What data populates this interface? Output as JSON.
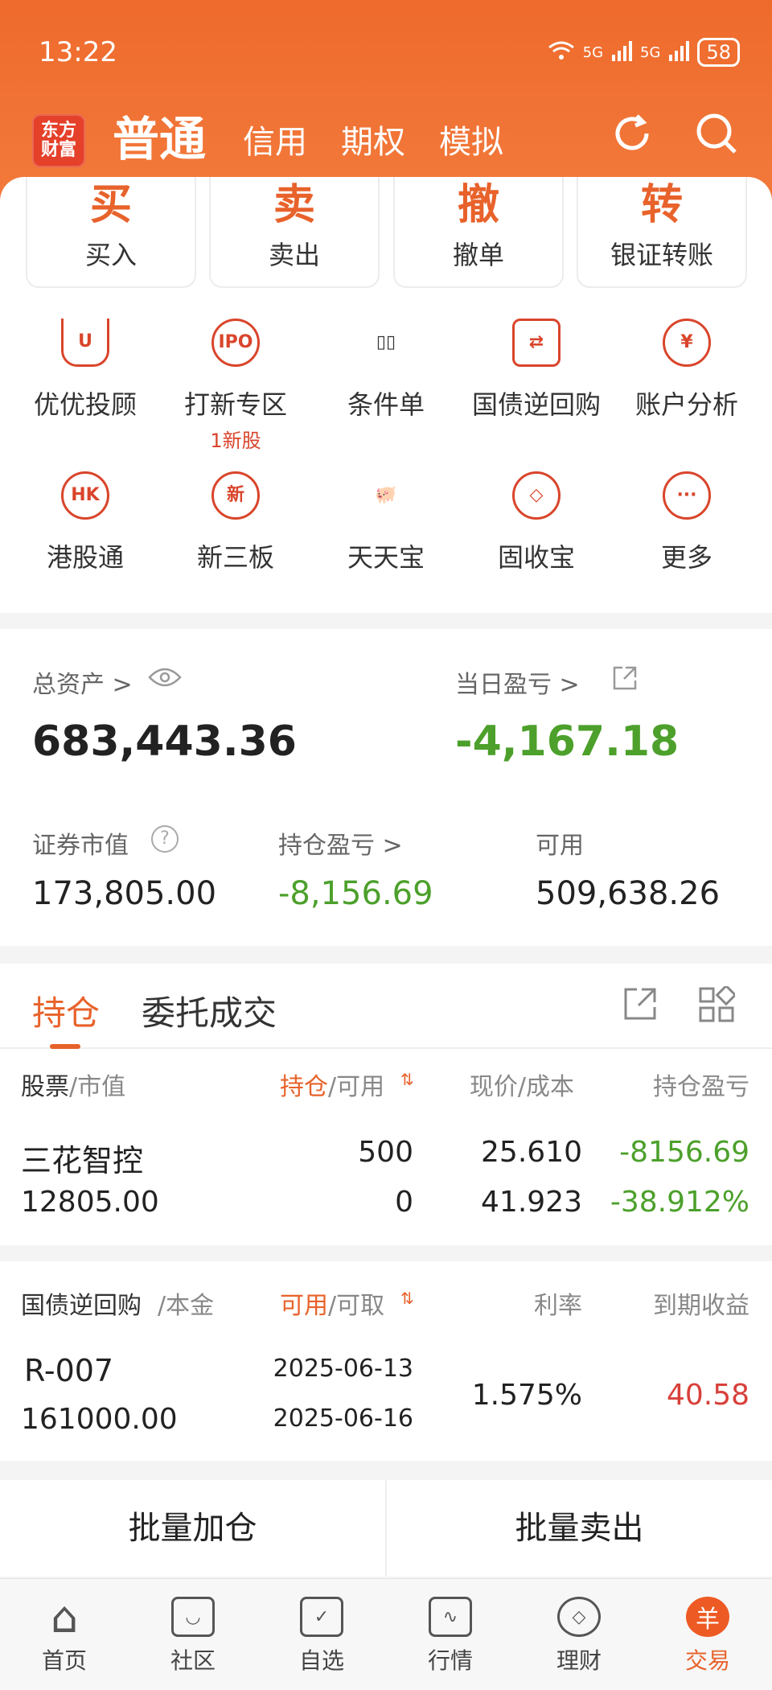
{
  "status_bar": {
    "time": "13:22",
    "network1": "5G",
    "network2": "5G",
    "battery": "58"
  },
  "header": {
    "logo_line1": "东方",
    "logo_line2": "财富",
    "tabs": [
      {
        "label": "普通",
        "active": true
      },
      {
        "label": "信用"
      },
      {
        "label": "期权"
      },
      {
        "label": "模拟"
      }
    ]
  },
  "actions": [
    {
      "big": "买",
      "label": "买入"
    },
    {
      "big": "卖",
      "label": "卖出"
    },
    {
      "big": "撤",
      "label": "撤单"
    },
    {
      "big": "转",
      "label": "银证转账"
    }
  ],
  "grid": [
    {
      "icon": "U",
      "label": "优优投顾"
    },
    {
      "icon": "IPO",
      "label": "打新专区",
      "sub": "1新股"
    },
    {
      "icon": "▯▯",
      "label": "条件单"
    },
    {
      "icon": "⇄",
      "label": "国债逆回购"
    },
    {
      "icon": "¥",
      "label": "账户分析"
    },
    {
      "icon": "HK",
      "label": "港股通"
    },
    {
      "icon": "新",
      "label": "新三板"
    },
    {
      "icon": "🐖",
      "label": "天天宝"
    },
    {
      "icon": "◇",
      "label": "固收宝"
    },
    {
      "icon": "···",
      "label": "更多"
    }
  ],
  "assets": {
    "total_label": "总资产 >",
    "total_value": "683,443.36",
    "daily_pl_label": "当日盈亏 >",
    "daily_pl_value": "-4,167.18",
    "market_value_label": "证券市值",
    "market_value": "173,805.00",
    "holding_pl_label": "持仓盈亏 >",
    "holding_pl_value": "-8,156.69",
    "available_label": "可用",
    "available_value": "509,638.26"
  },
  "holdings": {
    "tab_active": "持仓",
    "tab_other": "委托成交",
    "headers": {
      "c1a": "股票",
      "c1b": "/市值",
      "c2a": "持仓",
      "c2b": "/可用",
      "c3": "现价/成本",
      "c4": "持仓盈亏"
    },
    "rows": [
      {
        "name": "三花智控",
        "market_value": "12805.00",
        "position": "500",
        "available": "0",
        "price": "25.610",
        "cost": "41.923",
        "pl": "-8156.69",
        "pl_pct": "-38.912%"
      }
    ]
  },
  "repo": {
    "headers": {
      "c1a": "国债逆回购",
      "c1b": "/本金",
      "c2a": "可用",
      "c2b": "/可取",
      "c3": "利率",
      "c4": "到期收益"
    },
    "rows": [
      {
        "code": "R-007",
        "principal": "161000.00",
        "date1": "2025-06-13",
        "date2": "2025-06-16",
        "rate": "1.575%",
        "income": "40.58"
      }
    ]
  },
  "batch": {
    "add": "批量加仓",
    "sell": "批量卖出"
  },
  "nav": [
    {
      "label": "首页",
      "icon": "⌂"
    },
    {
      "label": "社区",
      "icon": "◡"
    },
    {
      "label": "自选",
      "icon": "✓"
    },
    {
      "label": "行情",
      "icon": "∿"
    },
    {
      "label": "理财",
      "icon": "◇"
    },
    {
      "label": "交易",
      "icon": "羊",
      "active": true
    }
  ],
  "colors": {
    "brand": "#ee6a2c",
    "loss": "#4ca02b",
    "gain": "#d8403a"
  }
}
